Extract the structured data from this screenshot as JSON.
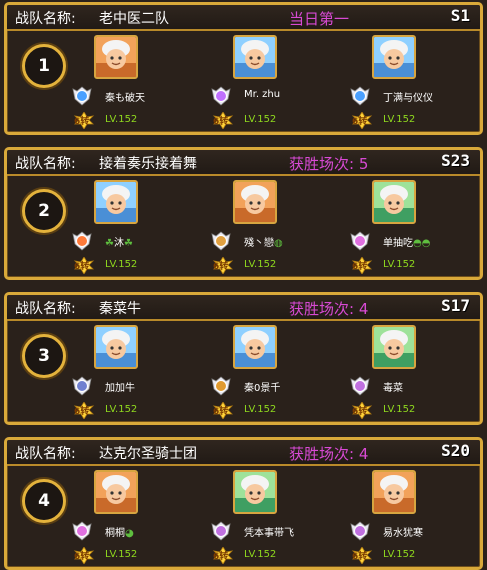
{
  "labels": {
    "team_prefix": "战队名称:",
    "wins_prefix": "获胜场次: "
  },
  "teams": [
    {
      "rank": "1",
      "name": "老中医二队",
      "extra": "当日第一",
      "server": "S1",
      "members": [
        {
          "name": "秦も破天",
          "level": "LV.152",
          "turn": "6转",
          "badge_color": "#4aa0ff",
          "avatar": "orange"
        },
        {
          "name": "Mr. zhu",
          "level": "LV.152",
          "turn": "6转",
          "badge_color": "#c070ff",
          "avatar": "blue"
        },
        {
          "name": "丁满与仪仪",
          "level": "LV.152",
          "turn": "6转",
          "badge_color": "#4aa0ff",
          "avatar": "blue"
        }
      ]
    },
    {
      "rank": "2",
      "name": "接着奏乐接着舞",
      "extra": "获胜场次: 5",
      "server": "S23",
      "members": [
        {
          "name": "沐",
          "decor_left": "☘",
          "decor_right": "☘",
          "level": "LV.152",
          "turn": "6转",
          "badge_color": "#ff7a3a",
          "avatar": "blue"
        },
        {
          "name": "殘丶戀",
          "decor_right": "◍",
          "level": "LV.152",
          "turn": "6转",
          "badge_color": "#e0a040",
          "avatar": "orange"
        },
        {
          "name": "单抽吃",
          "decor_right": "◓◓",
          "level": "LV.152",
          "turn": "6转",
          "badge_color": "#e070e0",
          "avatar": "green"
        }
      ]
    },
    {
      "rank": "3",
      "name": "秦菜牛",
      "extra": "获胜场次: 4",
      "server": "S17",
      "members": [
        {
          "name": "加加牛",
          "level": "LV.152",
          "turn": "6转",
          "badge_color": "#7080d0",
          "avatar": "blue"
        },
        {
          "name": "秦0景千",
          "level": "LV.152",
          "turn": "6转",
          "badge_color": "#e09a30",
          "avatar": "blue"
        },
        {
          "name": "毒菜",
          "level": "LV.152",
          "turn": "6转",
          "badge_color": "#c070e0",
          "avatar": "green"
        }
      ]
    },
    {
      "rank": "4",
      "name": "达克尔圣骑士团",
      "extra": "获胜场次: 4",
      "server": "S20",
      "members": [
        {
          "name": "桐桐",
          "decor_right": "◕",
          "level": "LV.152",
          "turn": "6转",
          "badge_color": "#e070e0",
          "avatar": "orange"
        },
        {
          "name": "凭本事带飞",
          "level": "LV.152",
          "turn": "6转",
          "badge_color": "#c070e0",
          "avatar": "green"
        },
        {
          "name": "易水犹寒",
          "level": "LV.152",
          "turn": "6转",
          "badge_color": "#c070e0",
          "avatar": "orange"
        }
      ]
    }
  ]
}
